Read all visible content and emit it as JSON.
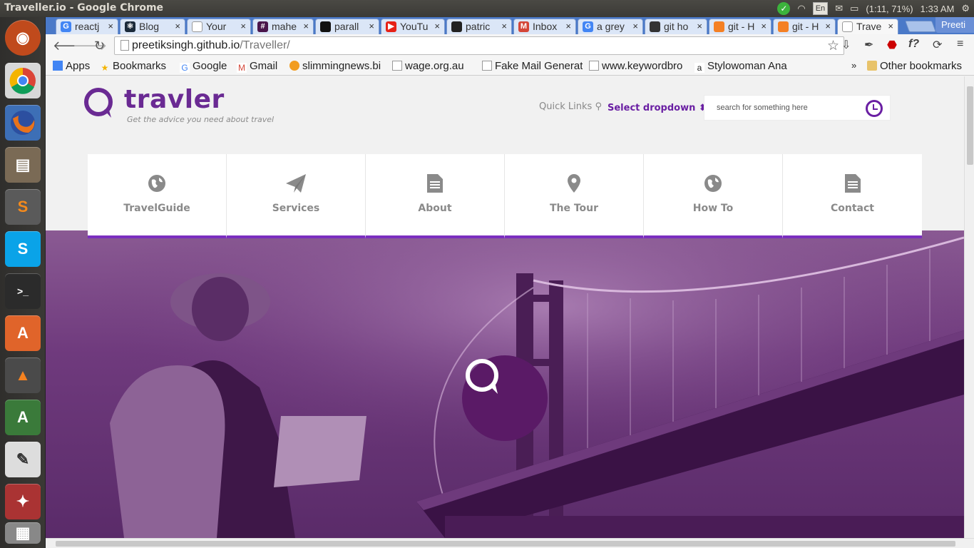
{
  "os": {
    "window_title": "Traveller.io - Google Chrome",
    "battery": "(1:11, 71%)",
    "time": "1:33 AM",
    "keyboard": "En"
  },
  "tabs": [
    {
      "label": "reactj",
      "fav_color": "#4285f4",
      "fav": "G"
    },
    {
      "label": "Blog",
      "fav_color": "#1b2a3a",
      "fav": "⚛"
    },
    {
      "label": "Your",
      "fav_color": "#ffffff",
      "fav": ""
    },
    {
      "label": "mahe",
      "fav_color": "#4a154b",
      "fav": "#"
    },
    {
      "label": "parall",
      "fav_color": "#111111",
      "fav": ""
    },
    {
      "label": "YouTu",
      "fav_color": "#e62117",
      "fav": "▶"
    },
    {
      "label": "patric",
      "fav_color": "#222222",
      "fav": ""
    },
    {
      "label": "Inbox",
      "fav_color": "#d44638",
      "fav": "M"
    },
    {
      "label": "a grey",
      "fav_color": "#4285f4",
      "fav": "G"
    },
    {
      "label": "git ho",
      "fav_color": "#333333",
      "fav": ""
    },
    {
      "label": "git - H",
      "fav_color": "#f48024",
      "fav": ""
    },
    {
      "label": "git - H",
      "fav_color": "#f48024",
      "fav": ""
    },
    {
      "label": "Trave",
      "fav_color": "#ffffff",
      "fav": "",
      "active": true
    }
  ],
  "profile": "Preeti",
  "toolbar": {
    "url_host": "preetiksingh.github.io",
    "url_path": "/Traveller/"
  },
  "bookmarks": [
    {
      "label": "Apps",
      "icon": "apps-icon"
    },
    {
      "label": "Bookmarks",
      "icon": "star-icon"
    },
    {
      "label": "Google",
      "icon": "google-icon"
    },
    {
      "label": "Gmail",
      "icon": "gmail-icon"
    },
    {
      "label": "slimmingnews.bi",
      "icon": "site-icon"
    },
    {
      "label": "wage.org.au",
      "icon": "page-icon"
    },
    {
      "label": "Fake Mail Generat",
      "icon": "page-icon"
    },
    {
      "label": "www.keywordbro",
      "icon": "page-icon"
    },
    {
      "label": "Stylowoman Ana",
      "icon": "amazon-icon"
    }
  ],
  "bookmarks_more": "»",
  "other_bookmarks": "Other bookmarks",
  "site": {
    "brand": "travler",
    "tagline": "Get the advice you need about travel",
    "quick_links": "Quick Links",
    "dropdown": "Select dropdown",
    "search_placeholder": "search for something here",
    "nav": [
      {
        "label": "TravelGuide",
        "icon": "globe-icon"
      },
      {
        "label": "Services",
        "icon": "paper-plane-icon"
      },
      {
        "label": "About",
        "icon": "document-icon"
      },
      {
        "label": "The Tour",
        "icon": "map-pin-icon"
      },
      {
        "label": "How To",
        "icon": "globe-icon"
      },
      {
        "label": "Contact",
        "icon": "document-icon"
      }
    ]
  },
  "colors": {
    "brand_purple": "#6a2a93",
    "accent": "#7b2fbf",
    "hero_overlay": "#6f3a7d"
  }
}
